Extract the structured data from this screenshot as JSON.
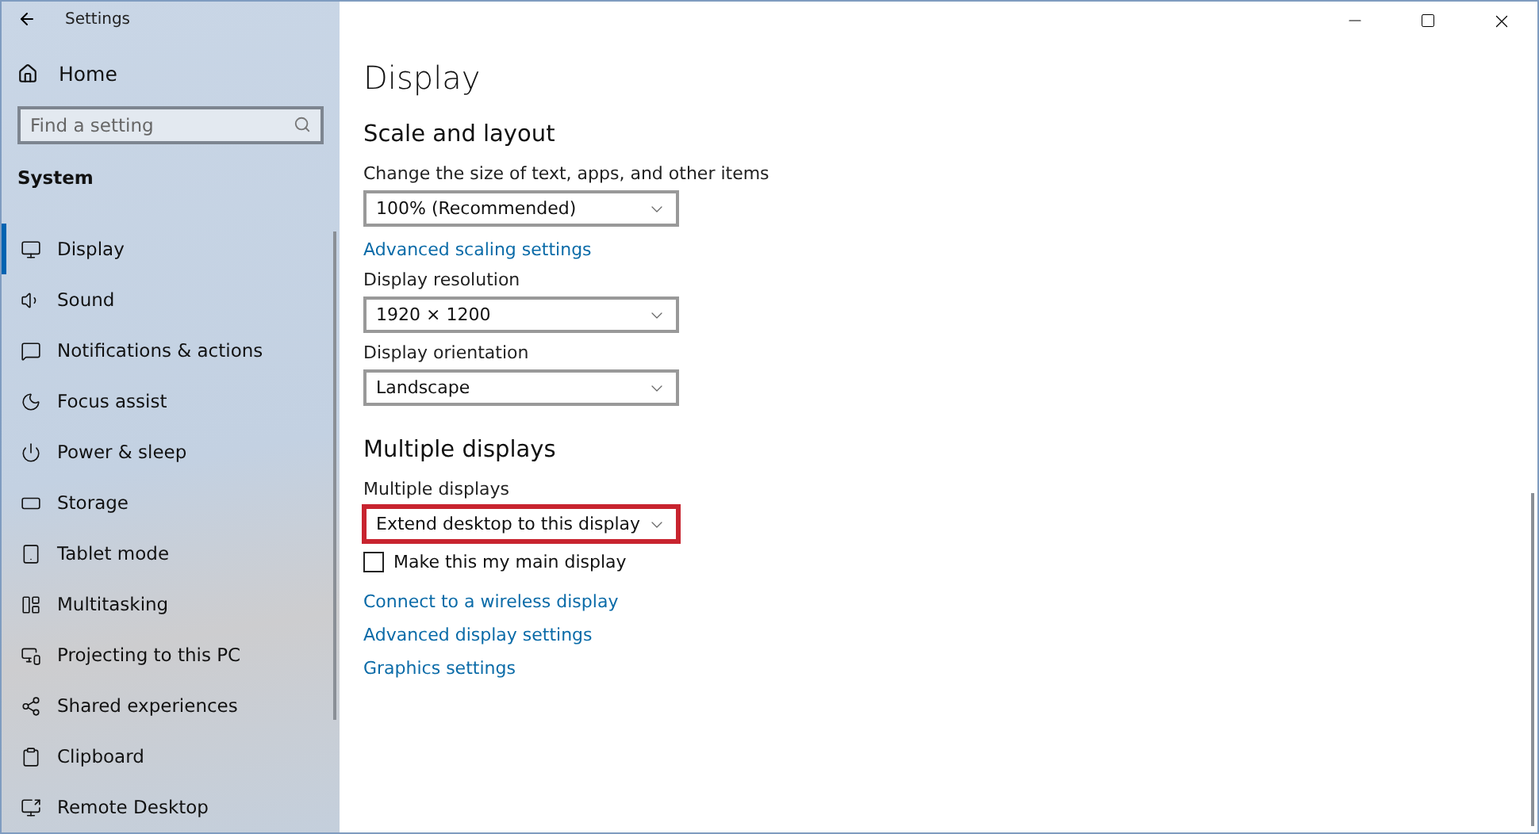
{
  "window": {
    "title": "Settings"
  },
  "sidebar": {
    "home": "Home",
    "search": {
      "placeholder": "Find a setting"
    },
    "section": "System",
    "items": [
      {
        "label": "Display",
        "selected": true
      },
      {
        "label": "Sound",
        "selected": false
      },
      {
        "label": "Notifications & actions",
        "selected": false
      },
      {
        "label": "Focus assist",
        "selected": false
      },
      {
        "label": "Power & sleep",
        "selected": false
      },
      {
        "label": "Storage",
        "selected": false
      },
      {
        "label": "Tablet mode",
        "selected": false
      },
      {
        "label": "Multitasking",
        "selected": false
      },
      {
        "label": "Projecting to this PC",
        "selected": false
      },
      {
        "label": "Shared experiences",
        "selected": false
      },
      {
        "label": "Clipboard",
        "selected": false
      },
      {
        "label": "Remote Desktop",
        "selected": false
      }
    ]
  },
  "content": {
    "title": "Display",
    "sections": [
      {
        "heading": "Scale and layout",
        "items": [
          {
            "kind": "dropdown",
            "label": "Change the size of text, apps, and other items",
            "value": "100% (Recommended)",
            "highlighted": false
          },
          {
            "kind": "link",
            "label": "Advanced scaling settings"
          },
          {
            "kind": "dropdown",
            "label": "Display resolution",
            "value": "1920 × 1200",
            "highlighted": false
          },
          {
            "kind": "dropdown",
            "label": "Display orientation",
            "value": "Landscape",
            "highlighted": false
          }
        ]
      },
      {
        "heading": "Multiple displays",
        "items": [
          {
            "kind": "dropdown",
            "label": "Multiple displays",
            "value": "Extend desktop to this display",
            "highlighted": true
          },
          {
            "kind": "checkbox",
            "label": "Make this my main display",
            "checked": false
          },
          {
            "kind": "link",
            "label": "Connect to a wireless display"
          },
          {
            "kind": "link",
            "label": "Advanced display settings"
          },
          {
            "kind": "link",
            "label": "Graphics settings"
          }
        ]
      }
    ]
  }
}
